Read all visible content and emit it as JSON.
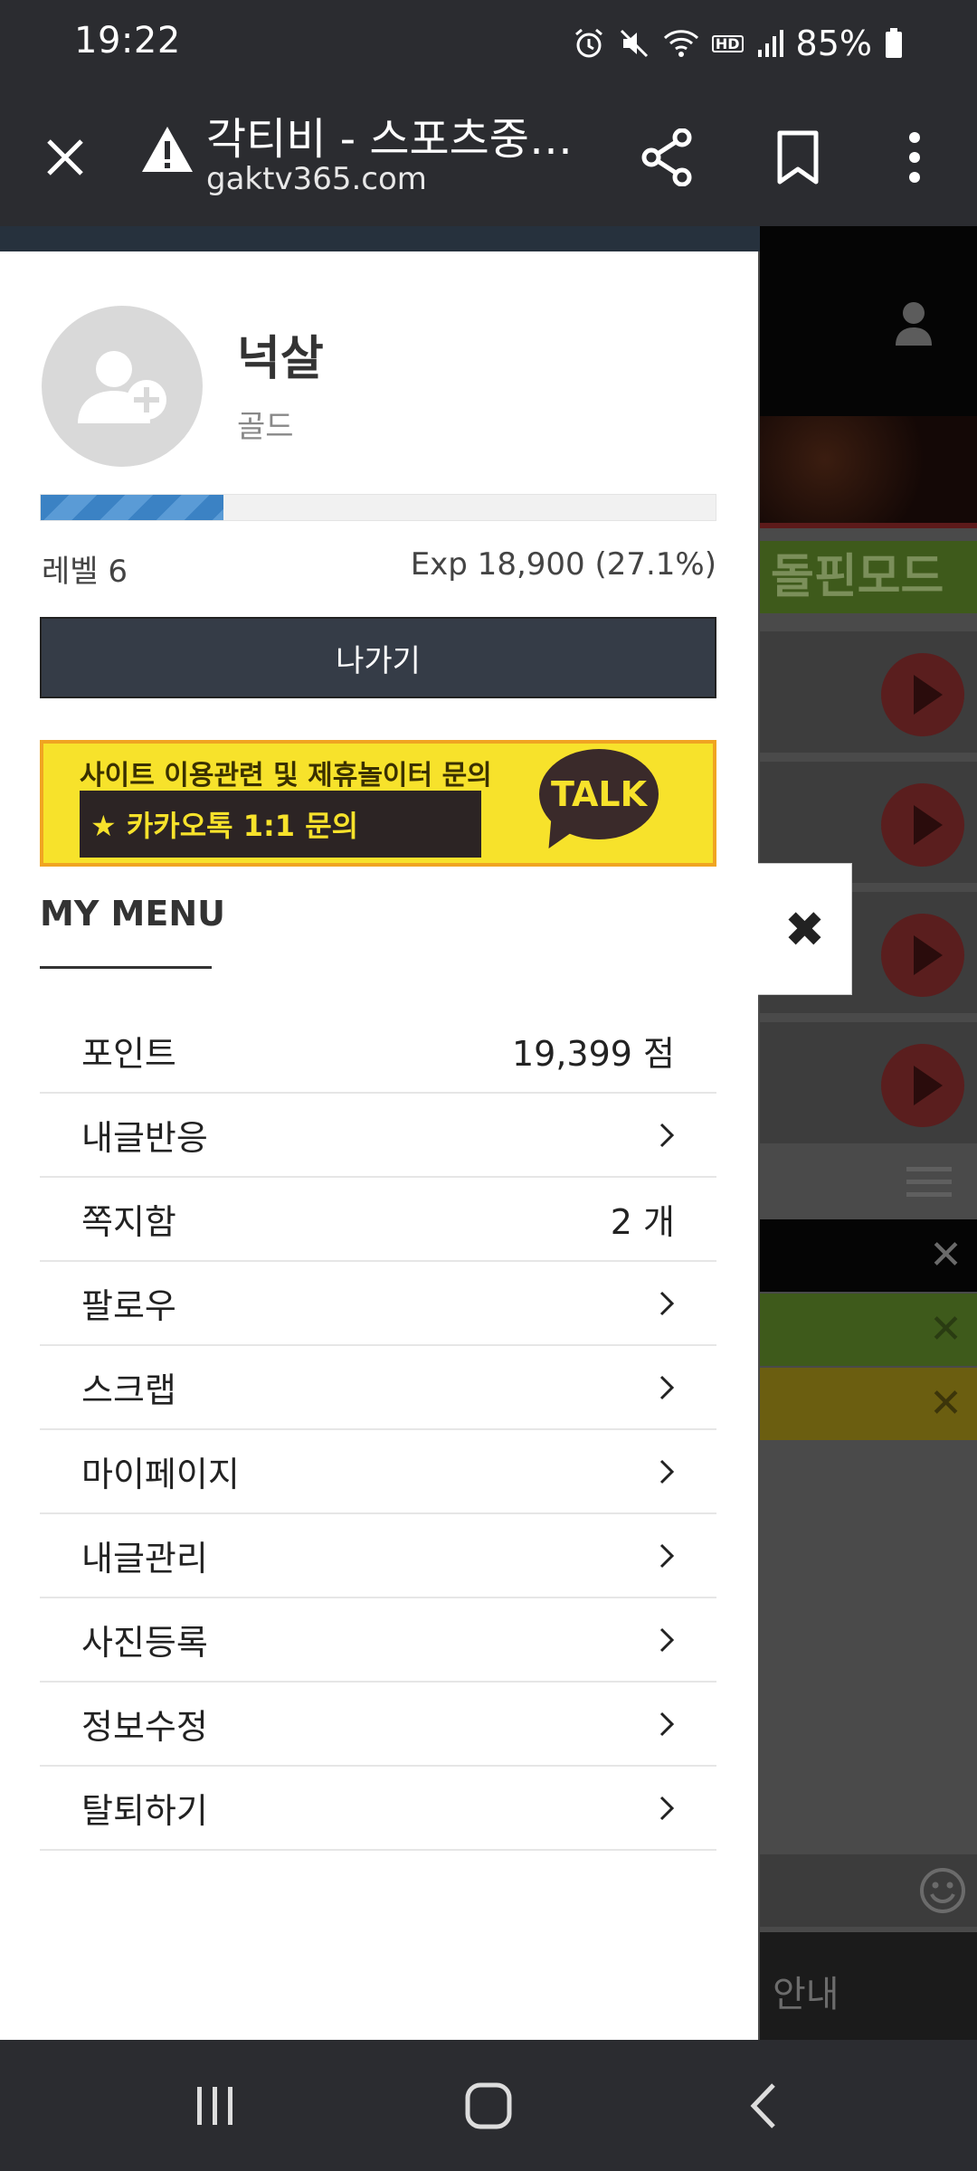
{
  "status_bar": {
    "time": "19:22",
    "icons": [
      "alarm-icon",
      "mute-icon",
      "wifi-icon",
      "hd-voice-icon",
      "signal-icon"
    ],
    "hd_label": "HD",
    "battery": "85%"
  },
  "browser": {
    "title": "각티비 - 스포츠중계...",
    "url": "gaktv365.com"
  },
  "background_page": {
    "banner_text": "돌핀모드",
    "notice_text": "안내"
  },
  "profile": {
    "nickname": "넉살",
    "grade": "골드",
    "level": "레벨 6",
    "exp": "Exp 18,900 (27.1%)",
    "exp_fraction": 0.271,
    "logout_label": "나가기"
  },
  "banner": {
    "line1": "사이트 이용관련 및 제휴놀이터 문의",
    "line2": "★ 카카오톡 1:1 문의",
    "talk": "TALK"
  },
  "my_menu": {
    "title": "MY MENU",
    "items": [
      {
        "label": "포인트",
        "value": "19,399 점"
      },
      {
        "label": "내글반응"
      },
      {
        "label": "쪽지함",
        "value": "2 개"
      },
      {
        "label": "팔로우"
      },
      {
        "label": "스크랩"
      },
      {
        "label": "마이페이지"
      },
      {
        "label": "내글관리"
      },
      {
        "label": "사진등록"
      },
      {
        "label": "정보수정"
      },
      {
        "label": "탈퇴하기"
      }
    ]
  },
  "close_label": "✖"
}
